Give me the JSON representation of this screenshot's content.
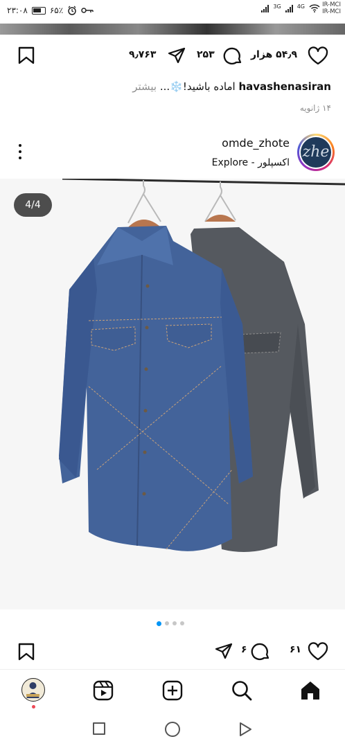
{
  "status_bar": {
    "time": "۲۳:۰۸",
    "battery": "۶۵٪",
    "carrier_1": "IR-MCI",
    "carrier_2": "IR-MCI",
    "network_1": "4G",
    "network_2": "3G"
  },
  "previous_post": {
    "likes": "۵۴٫۹ هزار",
    "comments": "۲۵۳",
    "shares": "۹٫۷۶۳",
    "caption_username": "havashenasiran",
    "caption_text": "اماده باشید!❄️...",
    "caption_more": "بیشتر",
    "date": "۱۴ ژانویه"
  },
  "post": {
    "avatar_text": "zhe",
    "username": "omde_zhote",
    "location": "اکسپلور - Explore",
    "image_counter": "4/4",
    "carousel_total": 4,
    "carousel_active": 1,
    "likes": "۶۱",
    "comments": "۶"
  },
  "bottom_nav": {
    "items": [
      "profile",
      "reels",
      "create",
      "search",
      "home"
    ],
    "active": "home"
  },
  "colors": {
    "accent_blue": "#0095f6",
    "notification_red": "#ed4956",
    "text_primary": "#111111",
    "text_secondary": "#8e8e8e"
  }
}
